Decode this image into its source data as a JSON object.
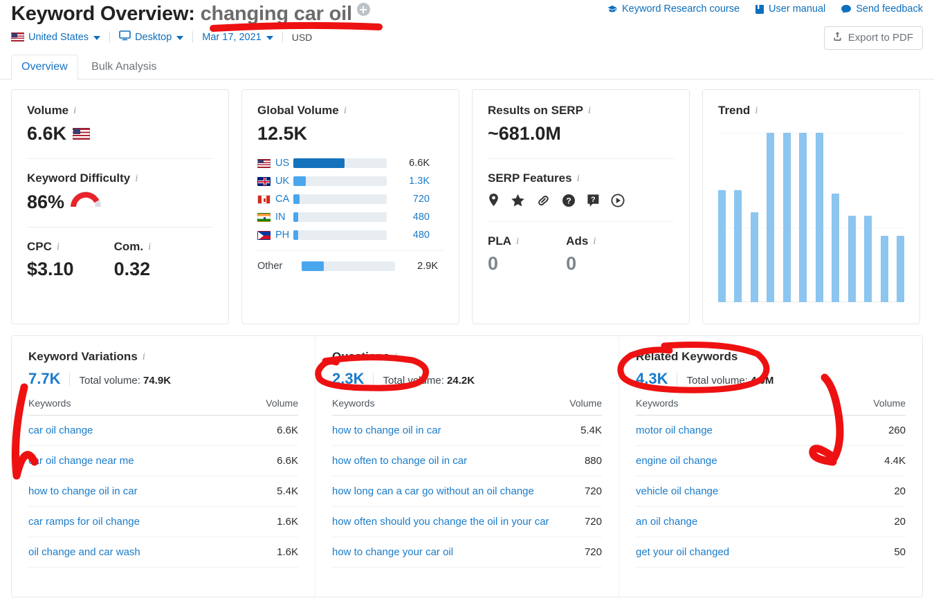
{
  "header": {
    "title_prefix": "Keyword Overview:",
    "keyword": "changing car oil",
    "add_icon": "plus-circle-icon",
    "links": [
      {
        "label": "Keyword Research course",
        "icon": "graduation-cap-icon"
      },
      {
        "label": "User manual",
        "icon": "book-icon"
      },
      {
        "label": "Send feedback",
        "icon": "chat-bubble-icon"
      }
    ],
    "export_label": "Export to PDF",
    "export_icon": "upload-icon"
  },
  "filters": {
    "country": "United States",
    "device": "Desktop",
    "date": "Mar 17, 2021",
    "currency": "USD"
  },
  "tabs": [
    {
      "label": "Overview",
      "active": true
    },
    {
      "label": "Bulk Analysis",
      "active": false
    }
  ],
  "volume_card": {
    "title": "Volume",
    "value": "6.6K",
    "kd_title": "Keyword Difficulty",
    "kd_value": "86%",
    "kd_percent": 86,
    "cpc_label": "CPC",
    "cpc_value": "$3.10",
    "com_label": "Com.",
    "com_value": "0.32"
  },
  "global_volume_card": {
    "title": "Global Volume",
    "value": "12.5K",
    "other_label": "Other",
    "other_value": "2.9K",
    "other_pct": 24,
    "rows": [
      {
        "code": "US",
        "value": "6.6K",
        "pct": 55
      },
      {
        "code": "UK",
        "value": "1.3K",
        "pct": 13
      },
      {
        "code": "CA",
        "value": "720",
        "pct": 7
      },
      {
        "code": "IN",
        "value": "480",
        "pct": 5
      },
      {
        "code": "PH",
        "value": "480",
        "pct": 5
      }
    ]
  },
  "serp_card": {
    "title": "Results on SERP",
    "value": "~681.0M",
    "features_title": "SERP Features",
    "features": [
      "map-pin-icon",
      "star-icon",
      "link-icon",
      "question-circle-icon",
      "question-bubble-icon",
      "play-circle-icon"
    ],
    "pla_label": "PLA",
    "pla_value": "0",
    "ads_label": "Ads",
    "ads_value": "0"
  },
  "trend_card": {
    "title": "Trend"
  },
  "chart_data": {
    "type": "bar",
    "title": "Trend",
    "xlabel": "",
    "ylabel": "",
    "categories": [
      "1",
      "2",
      "3",
      "4",
      "5",
      "6",
      "7",
      "8",
      "9",
      "10",
      "11",
      "12"
    ],
    "values": [
      0.66,
      0.66,
      0.53,
      1.0,
      1.0,
      1.0,
      1.0,
      0.64,
      0.51,
      0.51,
      0.39,
      0.39
    ],
    "ylim": [
      0,
      1
    ],
    "grid": true,
    "legend": "none",
    "color": "#8cc5ef"
  },
  "panels": [
    {
      "title": "Keyword Variations",
      "count": "7.7K",
      "total_label": "Total volume:",
      "total_value": "74.9K",
      "col_keyword": "Keywords",
      "col_volume": "Volume",
      "rows": [
        {
          "keyword": "car oil change",
          "volume": "6.6K"
        },
        {
          "keyword": "car oil change near me",
          "volume": "6.6K"
        },
        {
          "keyword": "how to change oil in car",
          "volume": "5.4K"
        },
        {
          "keyword": "car ramps for oil change",
          "volume": "1.6K"
        },
        {
          "keyword": "oil change and car wash",
          "volume": "1.6K"
        }
      ]
    },
    {
      "title": "Questions",
      "count": "2.3K",
      "total_label": "Total volume:",
      "total_value": "24.2K",
      "col_keyword": "Keywords",
      "col_volume": "Volume",
      "rows": [
        {
          "keyword": "how to change oil in car",
          "volume": "5.4K"
        },
        {
          "keyword": "how often to change oil in car",
          "volume": "880"
        },
        {
          "keyword": "how long can a car go without an oil change",
          "volume": "720"
        },
        {
          "keyword": "how often should you change the oil in your car",
          "volume": "720"
        },
        {
          "keyword": "how to change your car oil",
          "volume": "720"
        }
      ]
    },
    {
      "title": "Related Keywords",
      "count": "4.3K",
      "total_label": "Total volume:",
      "total_value": "4.0M",
      "col_keyword": "Keywords",
      "col_volume": "Volume",
      "rows": [
        {
          "keyword": "motor oil change",
          "volume": "260"
        },
        {
          "keyword": "engine oil change",
          "volume": "4.4K"
        },
        {
          "keyword": "vehicle oil change",
          "volume": "20"
        },
        {
          "keyword": "an oil change",
          "volume": "20"
        },
        {
          "keyword": "get your oil changed",
          "volume": "50"
        }
      ]
    }
  ],
  "annotations": {
    "color": "#ee1111",
    "marks": [
      "underline-under-keyword",
      "arrow-to-keyword-variations-first-row",
      "circle-around-questions",
      "circle-around-related-keywords",
      "arrow-to-related-keywords-volume"
    ]
  }
}
